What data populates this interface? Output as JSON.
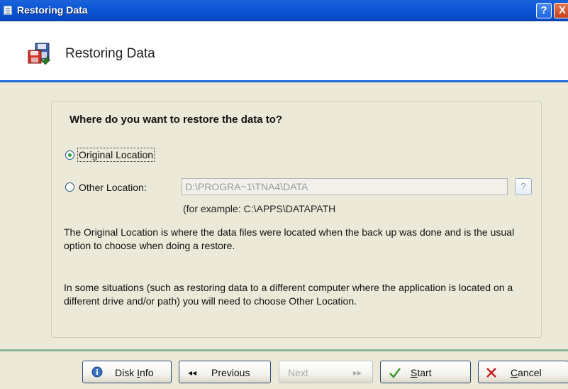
{
  "window": {
    "title": "Restoring Data",
    "help_glyph": "?",
    "close_glyph": "X"
  },
  "header": {
    "title": "Restoring Data",
    "icon": "restore-data-icon"
  },
  "form": {
    "question": "Where do you want to restore the data to?",
    "options": [
      {
        "label": "Original Location",
        "selected": true
      },
      {
        "label": "Other Location:",
        "selected": false
      }
    ],
    "other_location_value": "D:\\PROGRA~1\\TNA4\\DATA",
    "browse_glyph": "?",
    "example": "(for example: C:\\APPS\\DATAPATH",
    "paragraph1": "The Original Location is where the data files were located when the back up was done and is the usual option to choose when doing a restore.",
    "paragraph2": "In some situations (such as restoring data to a different computer where the application is located on a different drive and/or path) you will need to choose Other Location."
  },
  "buttons": {
    "disk_info": {
      "prefix": "Disk ",
      "mnemonic": "I",
      "suffix": "nfo",
      "icon": "info-icon"
    },
    "previous": {
      "label": "Previous",
      "icon": "rewind-icon",
      "glyph": "◂◂"
    },
    "next": {
      "label": "Next",
      "icon": "fast-forward-icon",
      "glyph": "▸▸",
      "enabled": false
    },
    "start": {
      "mnemonic": "S",
      "suffix": "tart",
      "icon": "checkmark-icon"
    },
    "cancel": {
      "mnemonic": "C",
      "suffix": "ancel",
      "icon": "x-icon"
    }
  },
  "colors": {
    "titlebar": "#0a56d6",
    "header_rule": "#1c6ad8",
    "footer_rule": "#8cb89a",
    "dialog_bg": "#ece9d8"
  }
}
